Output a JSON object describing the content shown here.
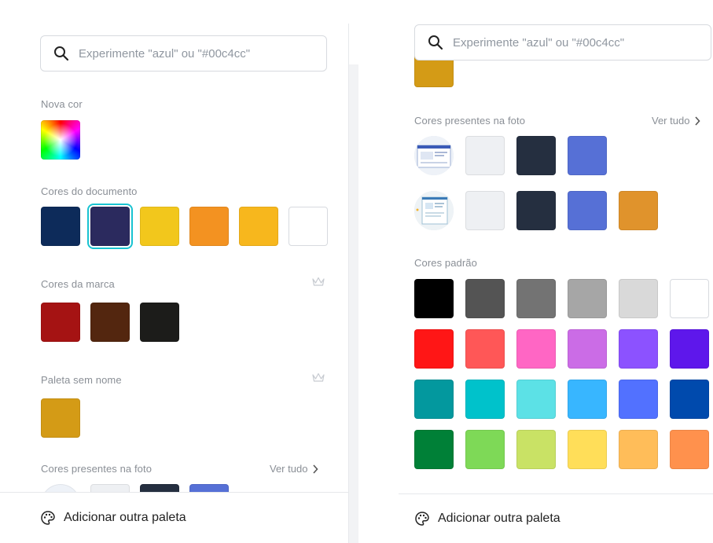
{
  "search": {
    "placeholder": "Experimente \"azul\" ou \"#00c4cc\""
  },
  "left": {
    "new_color_label": "Nova cor",
    "document_colors_label": "Cores do documento",
    "document_colors": [
      "#0d2b5a",
      "#2b2a5e",
      "#f2c71c",
      "#f39221",
      "#f7b71d",
      "#ffffff"
    ],
    "brand_colors_label": "Cores da marca",
    "brand_colors": [
      "#a51313",
      "#53260f",
      "#1c1c1a"
    ],
    "palette_label": "Paleta sem nome",
    "palette_colors": [
      "#d49b16"
    ],
    "photo_colors_label": "Cores presentes na foto",
    "see_all": "Ver tudo",
    "photo_colors_partial": [
      "#eef0f3",
      "#252f40",
      "#5670d6"
    ],
    "footer_label": "Adicionar outra paleta"
  },
  "right": {
    "top_partial_color": "#d49b16",
    "photo_colors_label": "Cores presentes na foto",
    "see_all": "Ver tudo",
    "photo_row1": [
      "#eef0f3",
      "#252f40",
      "#5670d6"
    ],
    "photo_row2": [
      "#eef0f3",
      "#252f40",
      "#5670d6",
      "#e0932c"
    ],
    "standard_label": "Cores padrão",
    "standard_colors": [
      [
        "#000000",
        "#545454",
        "#737373",
        "#a6a6a6",
        "#d9d9d9",
        "#ffffff"
      ],
      [
        "#ff1616",
        "#ff5757",
        "#ff66c4",
        "#cb6ce6",
        "#8c52ff",
        "#5e17eb"
      ],
      [
        "#03989e",
        "#00c2cb",
        "#5ce1e6",
        "#38b6ff",
        "#5271ff",
        "#004aad"
      ],
      [
        "#008037",
        "#7ed957",
        "#c9e265",
        "#ffde59",
        "#ffbd59",
        "#ff914d"
      ]
    ],
    "footer_label": "Adicionar outra paleta"
  },
  "colors": {
    "selection_outline": "#19c3d1",
    "crown": "#c7cbd1"
  }
}
